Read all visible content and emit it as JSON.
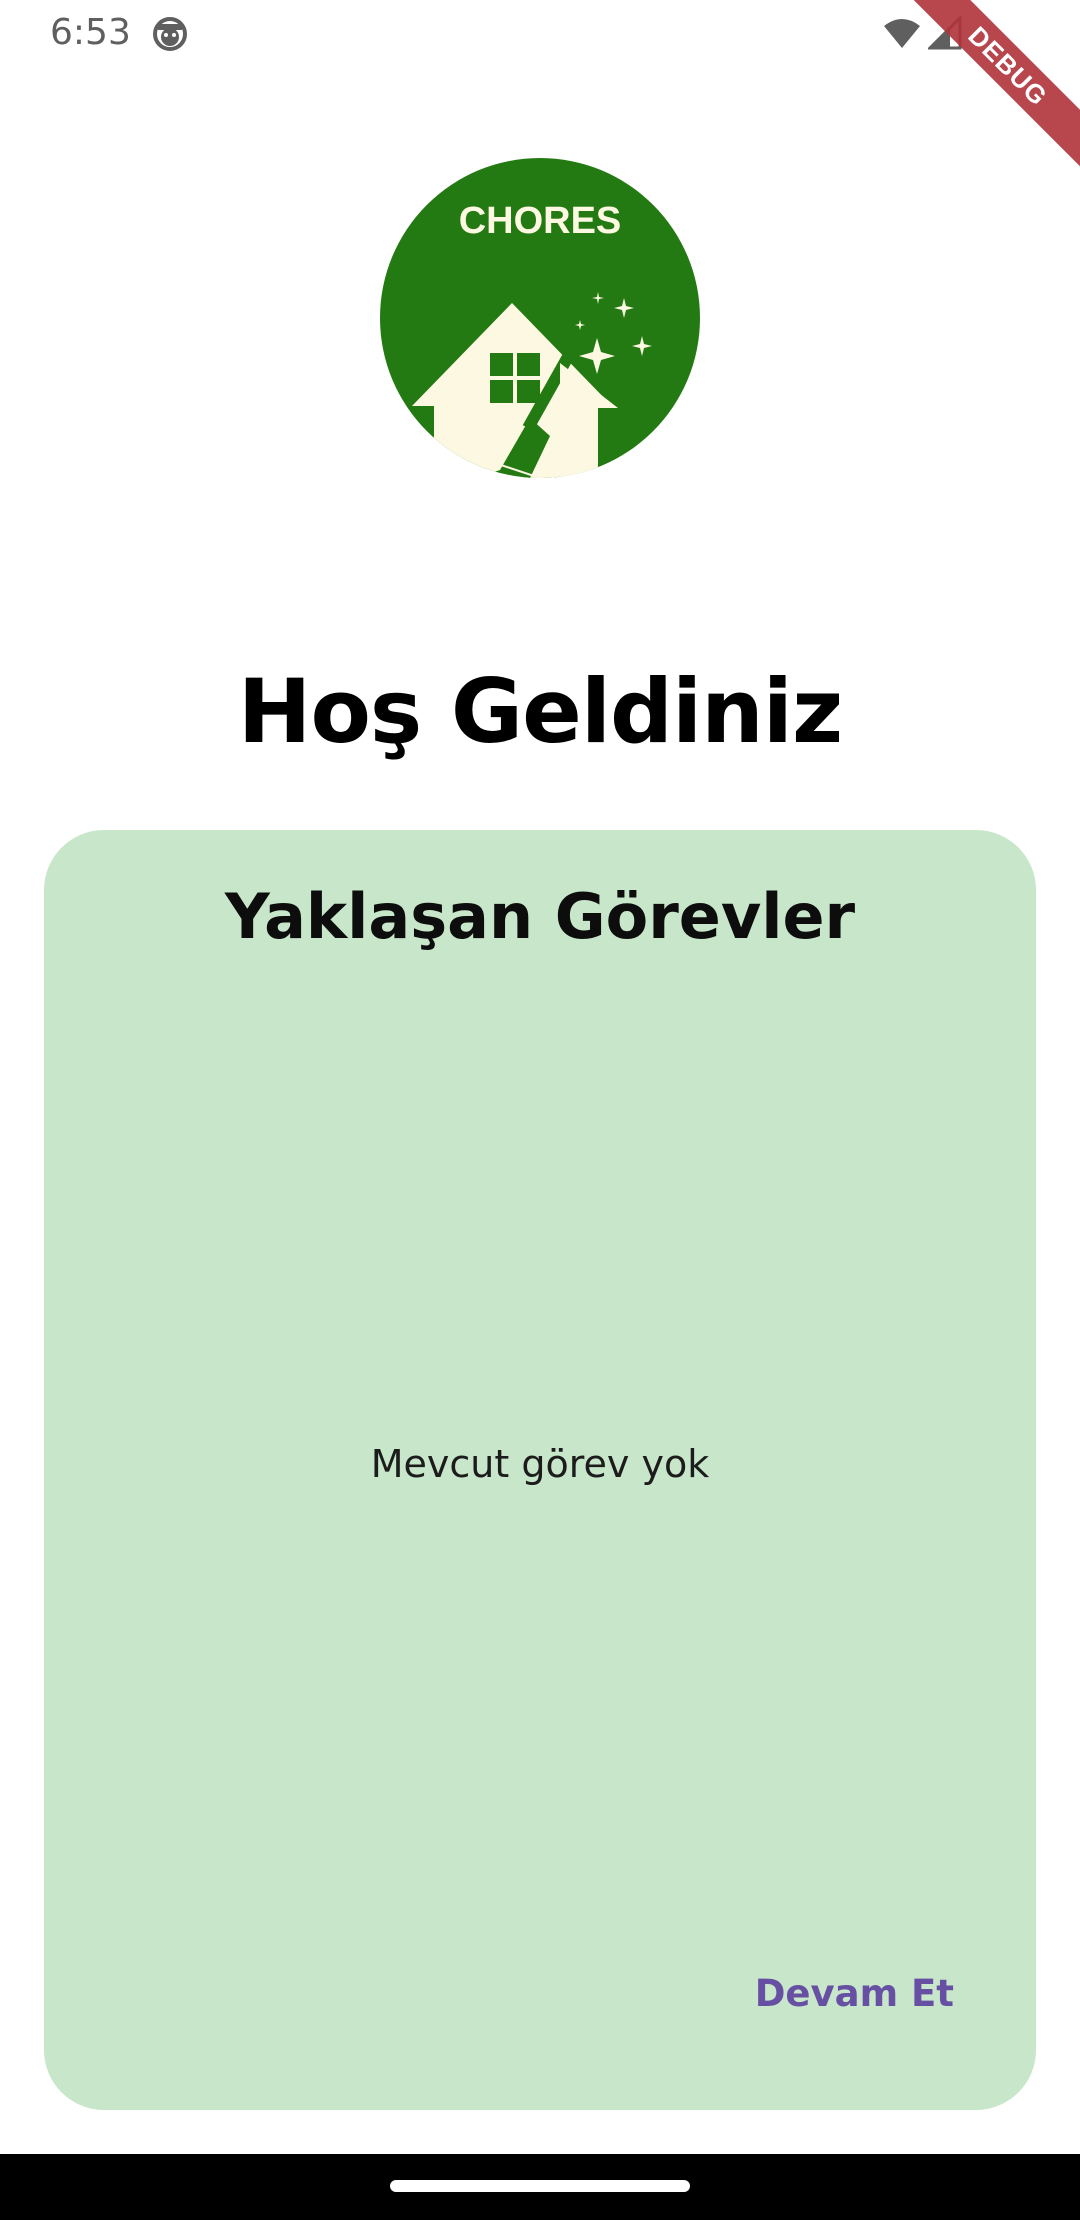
{
  "status_bar": {
    "time": "6:53",
    "app_icon": "android-face-icon",
    "wifi_icon": "wifi-icon",
    "signal_icon": "cell-signal-icon"
  },
  "debug_banner": {
    "label": "DEBUG"
  },
  "logo": {
    "text": "CHORES",
    "icon": "house-broom-logo",
    "background_color": "#237a12",
    "foreground_color": "#fdf8e1"
  },
  "welcome": {
    "title": "Hoş Geldiniz"
  },
  "tasks_card": {
    "title": "Yaklaşan Görevler",
    "empty_message": "Mevcut görev yok",
    "continue_label": "Devam Et",
    "background_color": "#c8e6c9",
    "accent_color": "#6750a4"
  },
  "nav_bar": {
    "home_indicator": "home-indicator"
  }
}
